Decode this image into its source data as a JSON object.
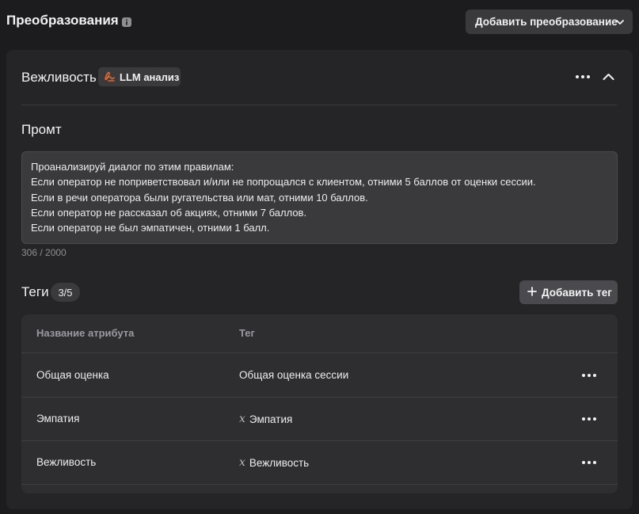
{
  "header": {
    "title": "Преобразования",
    "add_button_label": "Добавить преобразование"
  },
  "card": {
    "title": "Вежливость",
    "badge_label": "LLM анализ",
    "prompt_label": "Промт",
    "prompt_lines": [
      "Проанализируй диалог по этим правилам:",
      "Если оператор не поприветствовал и/или не попрощался с клиентом, отними 5 баллов от оценки сессии.",
      "Если в речи оператора были ругательства или мат, отними 10 баллов.",
      "Если оператор не рассказал об акциях, отними 7 баллов.",
      "Если оператор не был эмпатичен, отними 1 балл."
    ],
    "char_count": "306 / 2000",
    "tags_label": "Теги",
    "tags_count": "3/5",
    "add_tag_label": "Добавить тег",
    "table": {
      "columns": [
        "Название атрибута",
        "Тег"
      ],
      "rows": [
        {
          "attribute": "Общая оценка",
          "tag": "Общая оценка сессии",
          "variable": false
        },
        {
          "attribute": "Эмпатия",
          "tag": "Эмпатия",
          "variable": true
        },
        {
          "attribute": "Вежливость",
          "tag": "Вежливость",
          "variable": true
        }
      ]
    }
  },
  "colors": {
    "background": "#1c1c1e",
    "card": "#252527",
    "accent": "#e2672f"
  }
}
